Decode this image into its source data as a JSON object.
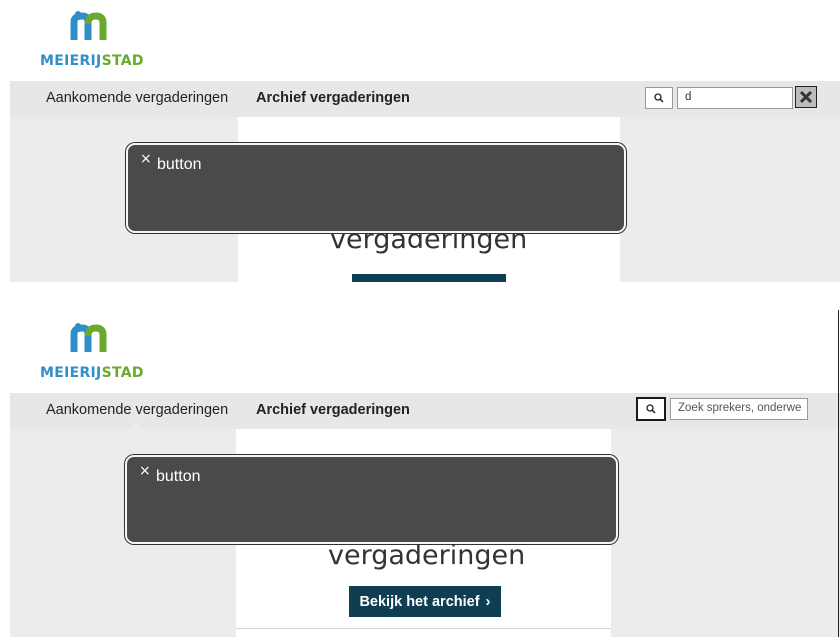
{
  "frames": {
    "top": {
      "logo": {
        "brand_part1": "MEIERIJ",
        "brand_part2": "STAD"
      },
      "nav": {
        "upcoming": "Aankomende vergaderingen",
        "archive": "Archief vergaderingen"
      },
      "search": {
        "value": "d"
      },
      "card": {
        "title": "vergaderingen"
      },
      "overlay": {
        "close": "×",
        "label": "button"
      }
    },
    "bottom": {
      "logo": {
        "brand_part1": "MEIERIJ",
        "brand_part2": "STAD"
      },
      "nav": {
        "upcoming": "Aankomende vergaderingen",
        "archive": "Archief vergaderingen"
      },
      "search": {
        "placeholder": "Zoek sprekers, onderwe"
      },
      "card": {
        "title": "vergaderingen",
        "button": "Bekijk het archief",
        "button_chevron": "›"
      },
      "overlay": {
        "close": "×",
        "label": "button"
      }
    }
  },
  "colors": {
    "brand_blue": "#2f8fc9",
    "brand_green": "#6aaa2a",
    "nav_bg": "#e7e7e7",
    "archive_button_bg": "#0f3d52",
    "overlay_bg": "#4a4a4a"
  },
  "icons": [
    "meierijstad-logo-icon",
    "search-icon",
    "clear-icon",
    "close-icon",
    "chevron-right-icon"
  ]
}
